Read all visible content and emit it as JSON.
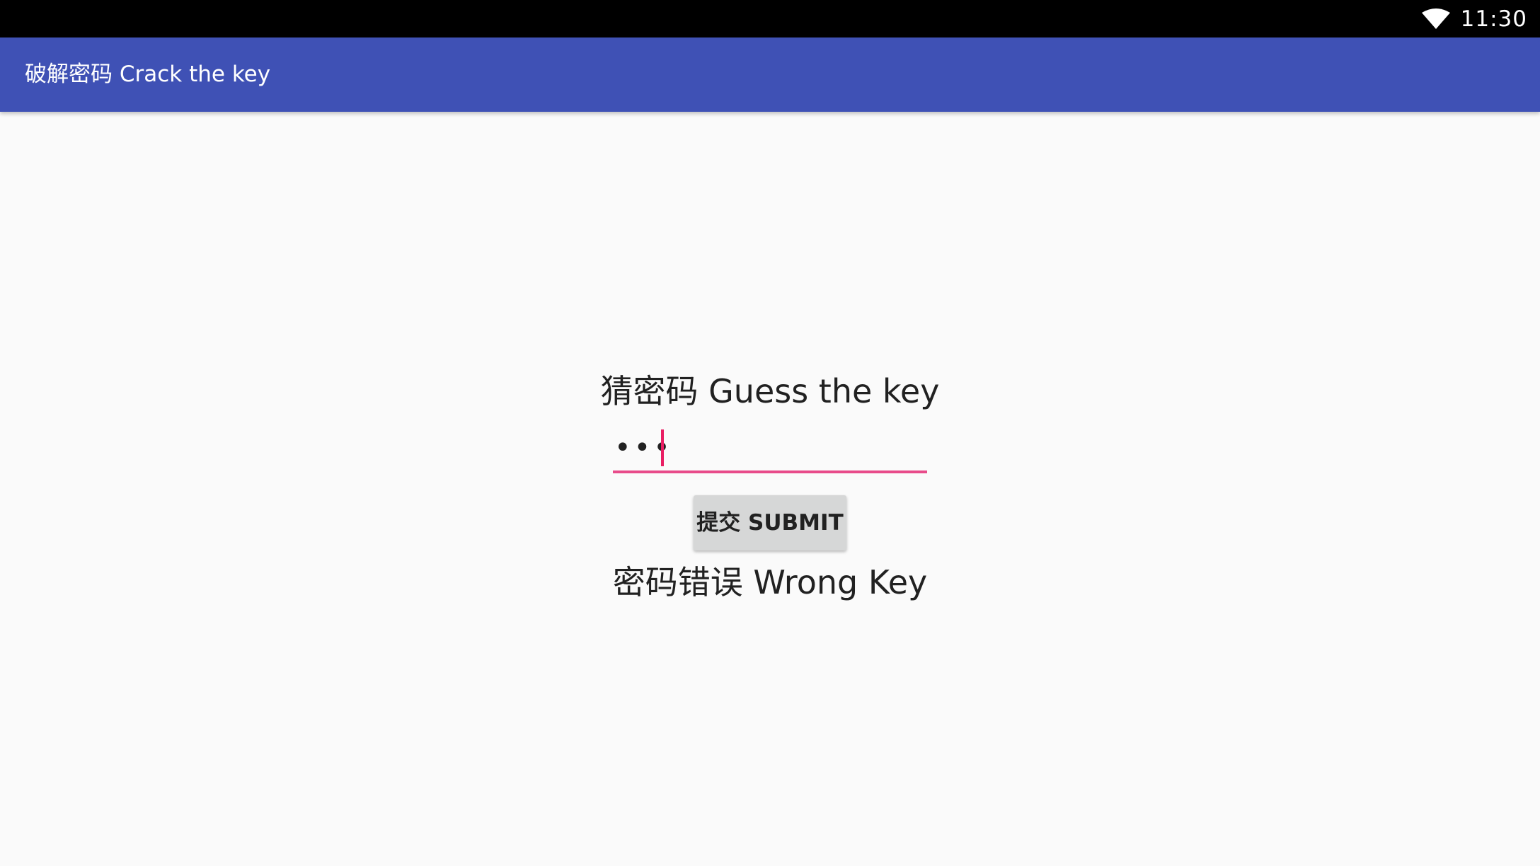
{
  "status_bar": {
    "time": "11:30",
    "wifi_icon": "wifi-icon"
  },
  "app_bar": {
    "title": "破解密码 Crack the key",
    "color": "#3f51b5"
  },
  "main": {
    "prompt": "猜密码 Guess the key",
    "password_input": {
      "value": "•••",
      "accent_color": "#e91e63"
    },
    "submit_label": "提交 SUBMIT",
    "result_message": "密码错误 Wrong Key"
  }
}
